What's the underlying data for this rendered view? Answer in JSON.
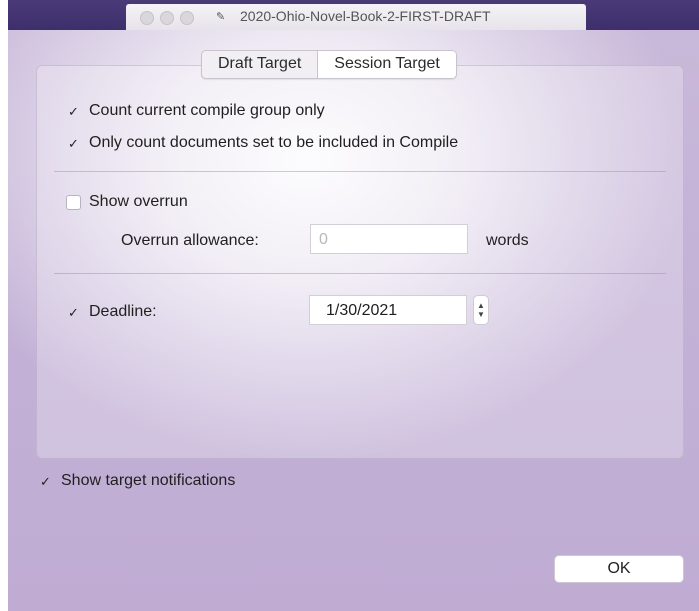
{
  "window": {
    "title": "2020-Ohio-Novel-Book-2-FIRST-DRAFT",
    "doc_icon_glyph": "✎"
  },
  "tabs": [
    {
      "label": "Draft Target",
      "active": false
    },
    {
      "label": "Session Target",
      "active": true
    }
  ],
  "options": {
    "compile_group": {
      "label": "Count current compile group only",
      "checked": true
    },
    "included_docs": {
      "label": "Only count documents set to be included in Compile",
      "checked": true
    },
    "show_overrun": {
      "label": "Show overrun",
      "checked": false
    },
    "overrun_allowance": {
      "label": "Overrun allowance:",
      "placeholder": "0",
      "unit": "words"
    },
    "deadline": {
      "label": "Deadline:",
      "checked": true,
      "value": "1/30/2021"
    },
    "notifications": {
      "label": "Show target notifications",
      "checked": true
    }
  },
  "check_glyph": "✓",
  "stepper_up": "▲",
  "stepper_down": "▼",
  "ok_button": "OK"
}
